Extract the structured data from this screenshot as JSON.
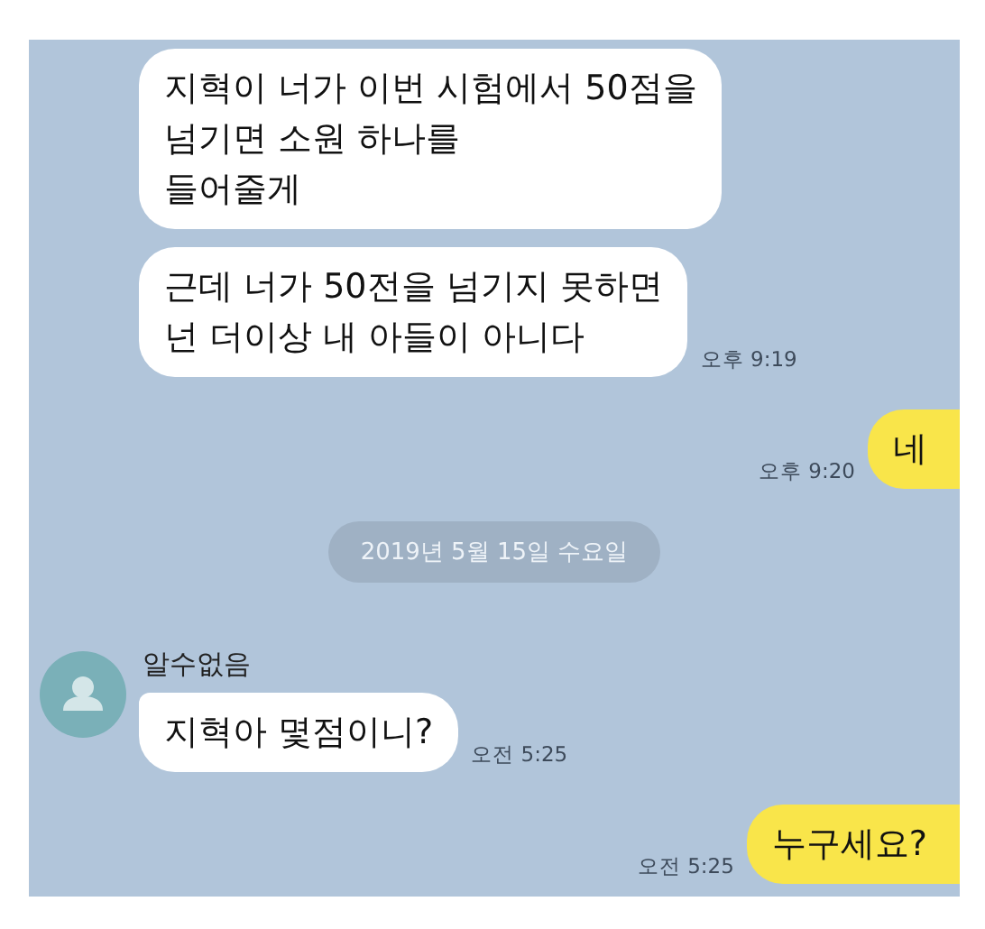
{
  "chat": {
    "items": [
      {
        "kind": "received",
        "bubbles": [
          {
            "text": "지혁이 너가 이번 시험에서 50점을\n넘기면 소원 하나를\n들어줄게"
          },
          {
            "text": "근데 너가 50전을 넘기지 못하면\n넌 더이상 내 아들이 아니다",
            "time": "오후 9:19"
          }
        ]
      },
      {
        "kind": "sent",
        "bubbles": [
          {
            "text": "네",
            "time": "오후 9:20"
          }
        ]
      },
      {
        "kind": "date",
        "text": "2019년 5월 15일 수요일"
      },
      {
        "kind": "received",
        "sender": "알수없음",
        "bubbles": [
          {
            "text": "지혁아 몇점이니?",
            "time": "오전 5:25"
          }
        ]
      },
      {
        "kind": "sent",
        "bubbles": [
          {
            "text": "누구세요?",
            "time": "오전 5:25"
          }
        ]
      }
    ]
  }
}
